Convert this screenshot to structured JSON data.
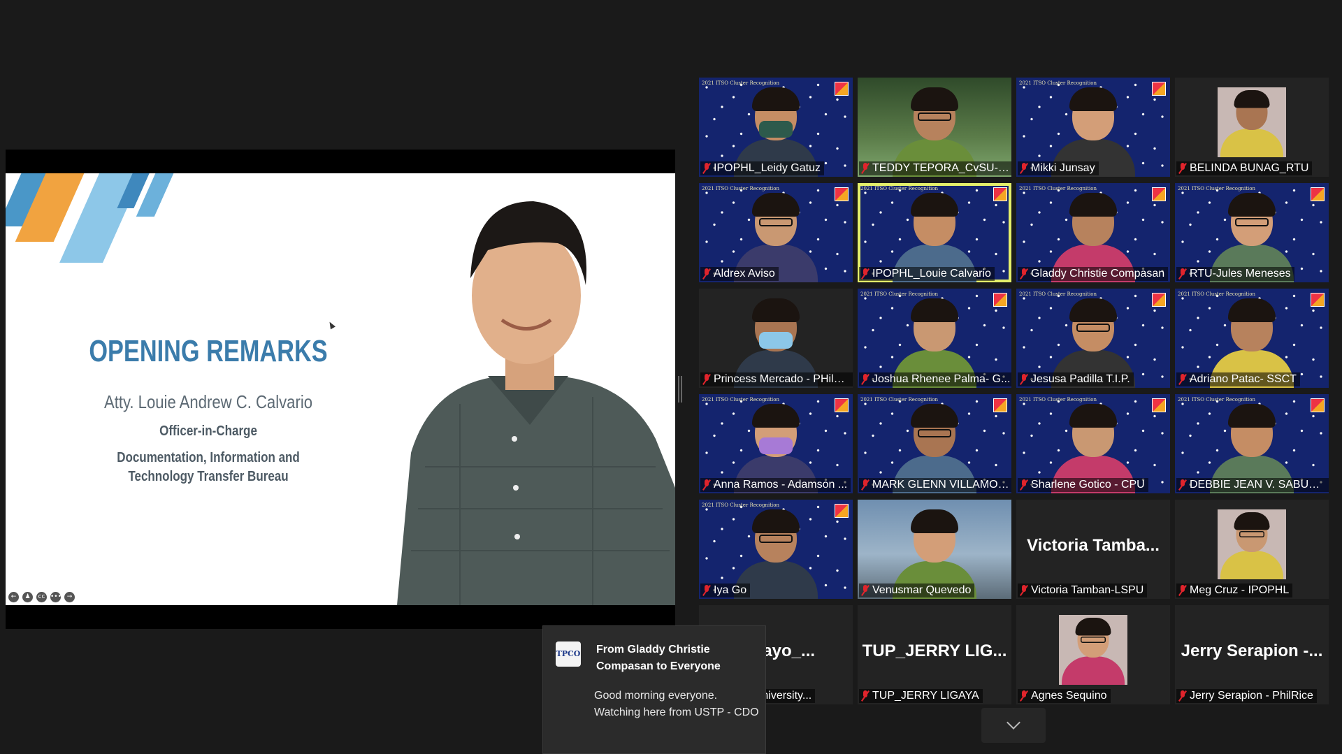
{
  "slide": {
    "title": "OPENING REMARKS",
    "speaker_name": "Atty. Louie Andrew C. Calvario",
    "role": "Officer-in-Charge",
    "department_line1": "Documentation, Information and",
    "department_line2": "Technology Transfer Bureau",
    "controls": [
      "←",
      "♟",
      "cc",
      "•••",
      "→"
    ]
  },
  "tile_banner": "2021 ITSO Cluster Recognition",
  "participants": [
    {
      "name": "IPOPHL_Leidy Gatuz",
      "bg": "starry"
    },
    {
      "name": "TEDDY TEPORA_CvSU-IT...",
      "bg": "green"
    },
    {
      "name": "Mikki Junsay",
      "bg": "starry"
    },
    {
      "name": "BELINDA BUNAG_RTU",
      "bg": "photo"
    },
    {
      "name": "Aldrex Aviso",
      "bg": "starry"
    },
    {
      "name": "IPOPHL_Louie Calvario",
      "bg": "starry",
      "speaking": true
    },
    {
      "name": "Gladdy Christie Compasan",
      "bg": "starry"
    },
    {
      "name": "RTU-Jules Meneses",
      "bg": "starry"
    },
    {
      "name": "Princess Mercado - PHilM...",
      "bg": "dark"
    },
    {
      "name": "Joshua Rhenee Palma- G...",
      "bg": "starry"
    },
    {
      "name": "Jesusa Padilla T.I.P.",
      "bg": "starry"
    },
    {
      "name": "Adriano Patac- SSCT",
      "bg": "starry"
    },
    {
      "name": "Anna Ramos - Adamson ...",
      "bg": "starry"
    },
    {
      "name": "MARK GLENN VILLAMOR...",
      "bg": "starry"
    },
    {
      "name": "Sharlene Gotico - CPU",
      "bg": "starry"
    },
    {
      "name": "DEBBIE JEAN V. SABUG- ...",
      "bg": "starry"
    },
    {
      "name": "Iya Go",
      "bg": "starry"
    },
    {
      "name": "Venusmar Quevedo",
      "bg": "building"
    },
    {
      "name": "Victoria Tamban-LSPU",
      "bg": "dark",
      "big": "Victoria  Tamba..."
    },
    {
      "name": "Meg Cruz - IPOPHL",
      "bg": "photo"
    },
    {
      "name": "Balayo_University...",
      "bg": "dark",
      "big": "Balayo_..."
    },
    {
      "name": "TUP_JERRY LIGAYA",
      "bg": "dark",
      "big": "TUP_JERRY  LIG..."
    },
    {
      "name": "Agnes Sequino",
      "bg": "photo"
    },
    {
      "name": "Jerry Serapion - PhilRice",
      "bg": "dark",
      "big": "Jerry Serapion -..."
    }
  ],
  "chat": {
    "avatar_text": "TPCO",
    "from": "From Gladdy Christie Compasan to Everyone",
    "message_line1": "Good morning everyone.",
    "message_line2": "Watching here from USTP - CDO"
  },
  "colors": {
    "accent_title": "#3b7cab",
    "active_speaker": "#e4ef6a",
    "muted_mic": "#e0242c"
  }
}
